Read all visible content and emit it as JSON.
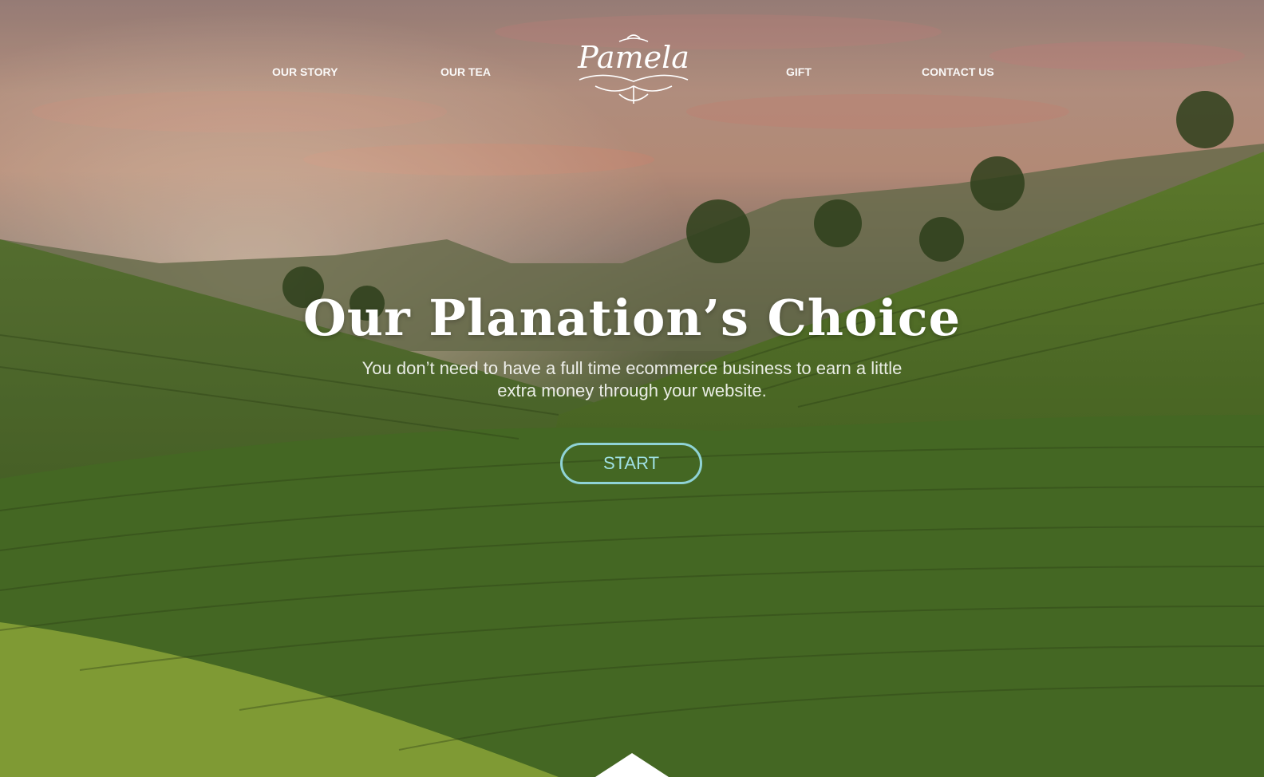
{
  "nav": {
    "items": [
      {
        "label": "OUR STORY"
      },
      {
        "label": "OUR TEA"
      },
      {
        "label": "GIFT"
      },
      {
        "label": "CONTACT US"
      }
    ],
    "logo_text": "Pamela"
  },
  "hero": {
    "title": "Our Planation’s Choice",
    "subtitle": "You don’t need to have a full time ecommerce business to earn a little extra money through your website.",
    "cta_label": "START"
  },
  "colors": {
    "cta_border": "#8fd3d6",
    "text": "#ffffff"
  },
  "icons": {
    "scroll": "chevron-up-icon"
  }
}
